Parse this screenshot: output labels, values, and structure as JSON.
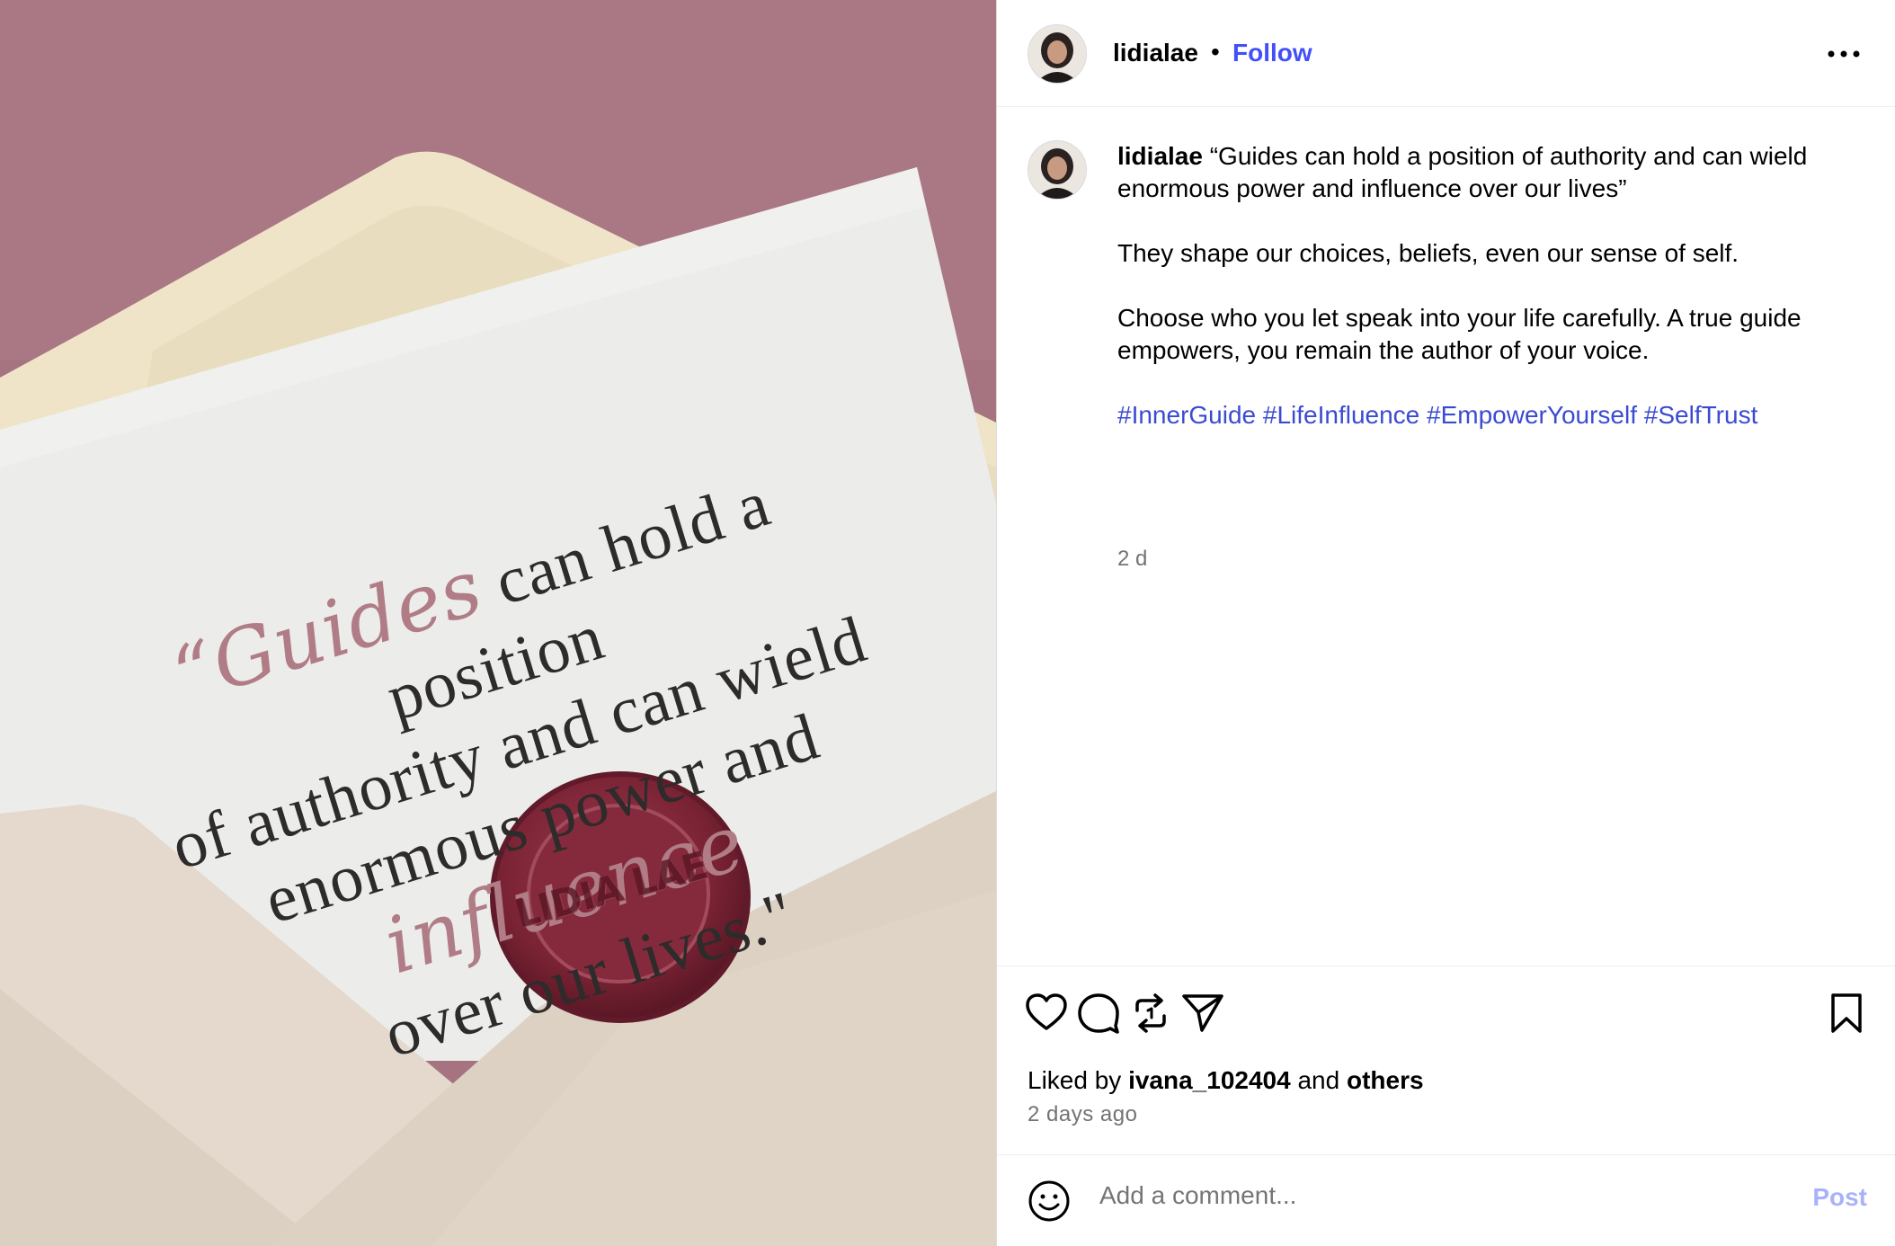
{
  "post": {
    "username": "lidialae",
    "separator": "•",
    "follow_label": "Follow",
    "more_icon": "more-horizontal-icon",
    "image": {
      "card_line1_script": "“Guides",
      "card_line1_rest": " can hold a position",
      "card_line2": "of authority and can wield",
      "card_line3_start": "enormous power and ",
      "card_line3_script": "influence",
      "card_line4": "over our lives.\"",
      "seal_text": "LIDIA LAE"
    },
    "caption": {
      "username": "lidialae",
      "quote": " “Guides can hold a position of authority and can wield enormous power and influence over our lives”",
      "para2": "They shape our choices, beliefs, even our sense of self.",
      "para3": "Choose who you let speak into your life carefully. A true guide empowers, you remain the author of your voice.",
      "hashtags": "#InnerGuide #LifeInfluence #EmpowerYourself #SelfTrust",
      "time": "2 d"
    },
    "actions": {
      "like_icon": "heart-icon",
      "comment_icon": "comment-icon",
      "repost_icon": "repost-icon",
      "share_icon": "send-icon",
      "save_icon": "bookmark-icon"
    },
    "likes": {
      "prefix": "Liked by ",
      "user": "ivana_102404",
      "middle": " and ",
      "others": "others"
    },
    "posted_ago": "2 days ago",
    "comment": {
      "placeholder": "Add a comment...",
      "post_label": "Post"
    }
  },
  "colors": {
    "accent": "#4150f7",
    "hashtag": "#3b4bd1",
    "background_mauve": "#a67380",
    "seal": "#7a2334"
  }
}
